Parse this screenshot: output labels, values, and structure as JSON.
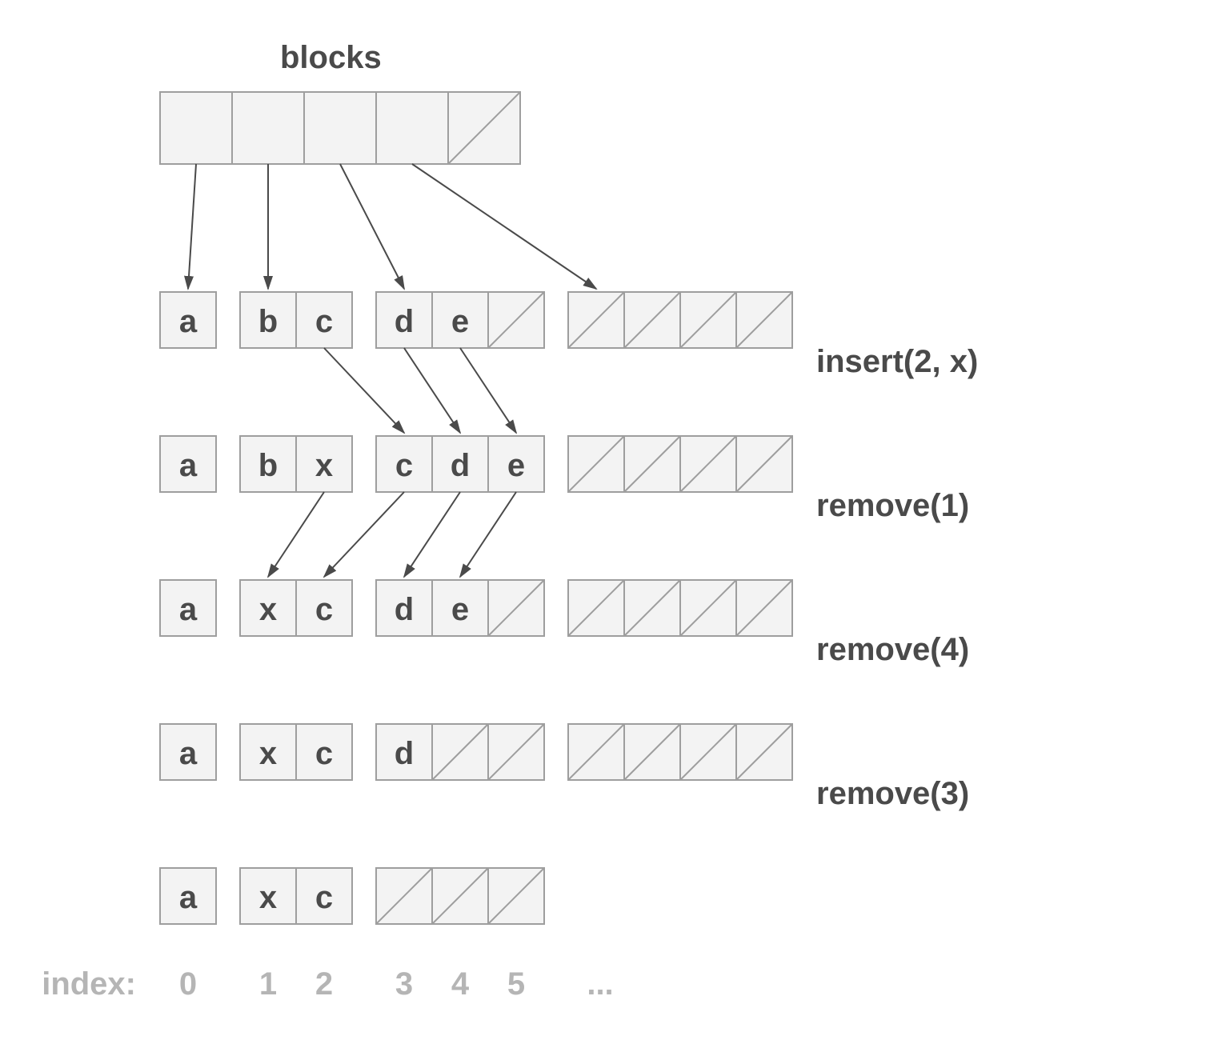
{
  "title": "blocks",
  "index_caption": "index:",
  "index_labels": [
    "0",
    "1",
    "2",
    "3",
    "4",
    "5",
    "..."
  ],
  "operations": {
    "op1": "insert(2, x)",
    "op2": "remove(1)",
    "op3": "remove(4)",
    "op4": "remove(3)"
  },
  "top_blocks": {
    "filled": 4,
    "empty": 1
  },
  "rows": [
    {
      "groups": [
        {
          "cells": [
            "a"
          ],
          "empty": 0
        },
        {
          "cells": [
            "b",
            "c"
          ],
          "empty": 0
        },
        {
          "cells": [
            "d",
            "e"
          ],
          "empty": 1
        },
        {
          "cells": [],
          "empty": 4
        }
      ]
    },
    {
      "groups": [
        {
          "cells": [
            "a"
          ],
          "empty": 0
        },
        {
          "cells": [
            "b",
            "x"
          ],
          "empty": 0
        },
        {
          "cells": [
            "c",
            "d",
            "e"
          ],
          "empty": 0
        },
        {
          "cells": [],
          "empty": 4
        }
      ]
    },
    {
      "groups": [
        {
          "cells": [
            "a"
          ],
          "empty": 0
        },
        {
          "cells": [
            "x",
            "c"
          ],
          "empty": 0
        },
        {
          "cells": [
            "d",
            "e"
          ],
          "empty": 1
        },
        {
          "cells": [],
          "empty": 4
        }
      ]
    },
    {
      "groups": [
        {
          "cells": [
            "a"
          ],
          "empty": 0
        },
        {
          "cells": [
            "x",
            "c"
          ],
          "empty": 0
        },
        {
          "cells": [
            "d"
          ],
          "empty": 2
        },
        {
          "cells": [],
          "empty": 4
        }
      ]
    },
    {
      "groups": [
        {
          "cells": [
            "a"
          ],
          "empty": 0
        },
        {
          "cells": [
            "x",
            "c"
          ],
          "empty": 0
        },
        {
          "cells": [],
          "empty": 3
        }
      ]
    }
  ]
}
